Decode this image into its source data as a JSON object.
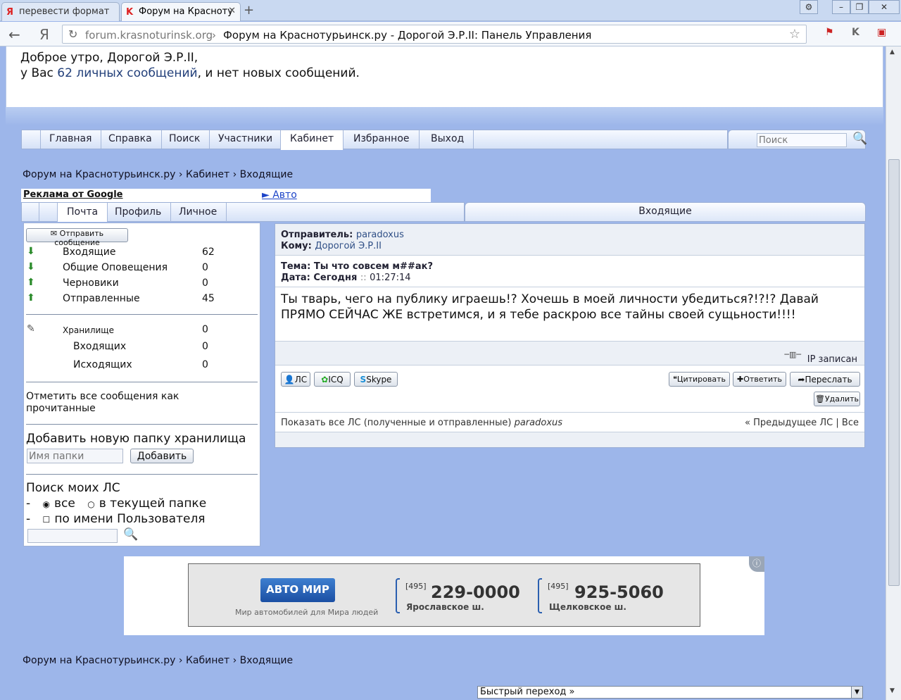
{
  "browser": {
    "tabs": [
      {
        "favicon": "Я",
        "label": "перевести формат"
      },
      {
        "favicon": "K",
        "label": "Форум на Красноту"
      }
    ],
    "new_tab": "+",
    "url_host": "forum.krasnoturinsk.org",
    "url_sep": "›",
    "page_title": "Форум на Краснотурьинск.ру - Дорогой Э.Р.II: Панель Управления"
  },
  "welcome": {
    "greeting": "Доброе утро, Дорогой Э.Р.II,",
    "pm_prefix": "у Вас ",
    "pm_link": "62 личных сообщений",
    "pm_suffix": ", и нет новых сообщений."
  },
  "nav": {
    "items": [
      "Главная",
      "Справка",
      "Поиск",
      "Участники",
      "Кабинет",
      "Избранное",
      "Выход"
    ],
    "active": "Кабинет",
    "search_placeholder": "Поиск"
  },
  "breadcrumb": {
    "forum": "Форум на Краснотурьинск.ру",
    "sep": "›",
    "cabinet": "Кабинет",
    "page": "Входящие"
  },
  "adrow": {
    "google": "Реклама от Google",
    "link": "► Авто"
  },
  "subnav": {
    "items": [
      "Почта",
      "Профиль",
      "Личное"
    ],
    "active": "Почта",
    "right_title": "Входящие"
  },
  "left": {
    "send_button": "Отправить сообщение",
    "folders": [
      {
        "name": "Входящие",
        "count": "62"
      },
      {
        "name": "Общие Оповещения",
        "count": "0"
      },
      {
        "name": "Черновики",
        "count": "0"
      },
      {
        "name": "Отправленные",
        "count": "45"
      }
    ],
    "storage": {
      "name": "Хранилище",
      "count": "0",
      "in_name": "Входящих",
      "in_count": "0",
      "out_name": "Исходящих",
      "out_count": "0"
    },
    "mark_all_read": "Отметить все сообщения как прочитанные",
    "add_folder_title": "Добавить новую папку хранилища",
    "folder_placeholder": "Имя папки",
    "add_button": "Добавить",
    "search_title": "Поиск моих ЛС",
    "opt_all": "все",
    "opt_current": "в текущей папке",
    "opt_by_user": "по имени Пользователя"
  },
  "message": {
    "from_label": "Отправитель:",
    "from": "paradoxus",
    "to_label": "Кому:",
    "to": "Дорогой Э.Р.II",
    "subject_label": "Тема:",
    "subject": "Ты что совсем м##ак?",
    "date_label": "Дата:",
    "date": "Сегодня",
    "date_sep": "::",
    "time": "01:27:14",
    "body": "Ты тварь, чего на публику играешь!? Хочешь в моей личности убедиться?!?!? Давай ПРЯМО СЕЙЧАС ЖЕ встретимся, и я тебе раскрою все тайны своей сущьности!!!!",
    "ip_status": "IP записан",
    "contact_buttons": [
      "ЛС",
      "ICQ",
      "Skype"
    ],
    "action_buttons": [
      "Цитировать",
      "Ответить",
      "Переслать",
      "Удалить"
    ],
    "show_all": "Показать все ЛС (полученные и отправленные)",
    "show_all_user": "paradoxus",
    "prev": "« Предыдущее ЛС",
    "all": "Все"
  },
  "banner": {
    "logo": "АВТО МИР",
    "tagline": "Мир автомобилей для Мира людей",
    "code1": "[495]",
    "phone1": "229-0000",
    "loc1": "Ярославское ш.",
    "code2": "[495]",
    "phone2": "925-5060",
    "loc2": "Щелковское ш."
  },
  "quick_jump": "Быстрый переход »",
  "colors": {
    "page_bg": "#9db6ea",
    "link": "#23407a",
    "ad_link": "#1c44c8"
  }
}
